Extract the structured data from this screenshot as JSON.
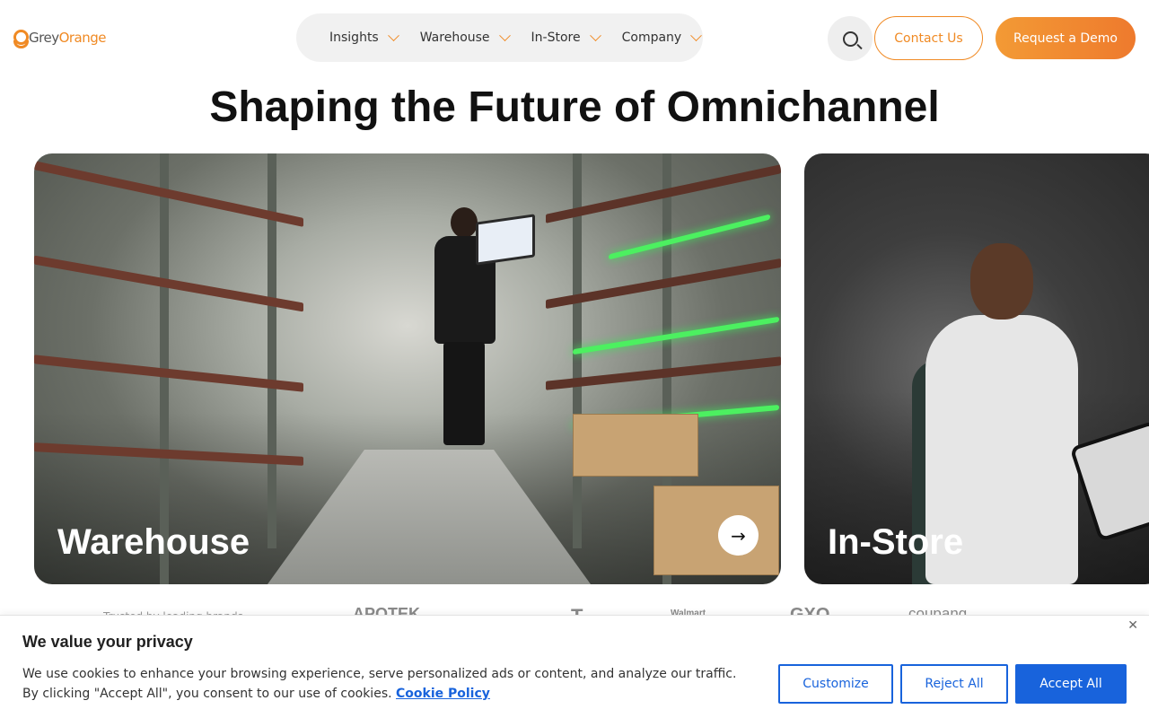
{
  "header": {
    "logo_grey": "Grey",
    "logo_orange": "Orange",
    "nav": [
      "Insights",
      "Warehouse",
      "In-Store",
      "Company"
    ],
    "contact_label": "Contact Us",
    "demo_label": "Request a Demo"
  },
  "hero": {
    "title": "Shaping the Future of Omnichannel"
  },
  "cards": {
    "warehouse": "Warehouse",
    "instore": "In-Store"
  },
  "brands": {
    "trusted_label": "Trusted by leading brands",
    "logos": [
      "APOTEK",
      "Walmart",
      "GXO",
      "coupang"
    ]
  },
  "cookie": {
    "title": "We value your privacy",
    "text": "We use cookies to enhance your browsing experience, serve personalized ads or content, and analyze our traffic. By clicking \"Accept All\", you consent to our use of cookies.",
    "policy_link": "Cookie Policy",
    "customize": "Customize",
    "reject": "Reject All",
    "accept": "Accept All",
    "close": "✕"
  },
  "colors": {
    "brand_orange": "#f08a24",
    "cookie_blue": "#1863dc"
  }
}
